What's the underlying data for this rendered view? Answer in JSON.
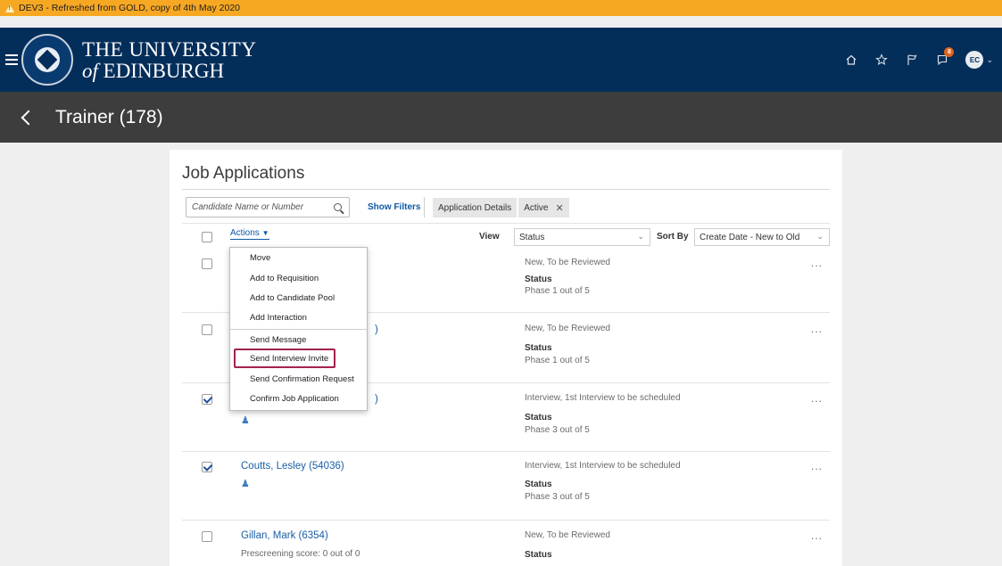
{
  "warning_bar": {
    "text": "DEV3 - Refreshed from GOLD, copy of 4th May 2020"
  },
  "header": {
    "title_line1": "THE UNIVERSITY",
    "title_of": "of",
    "title_line2": "EDINBURGH",
    "notification_count": "8",
    "avatar_initials": "EC",
    "colors": {
      "header_bg": "#042e5a",
      "warning_bg": "#f7a823",
      "badge": "#e2621b"
    }
  },
  "page": {
    "title": "Trainer (178)"
  },
  "panel": {
    "heading": "Job Applications",
    "search": {
      "placeholder": "Candidate Name or Number"
    },
    "show_filters": "Show Filters",
    "filter_pills": [
      {
        "label": "Application Details"
      },
      {
        "label": "Active",
        "removable": true
      }
    ],
    "actions_label": "Actions",
    "view_label": "View",
    "view_value": "Status",
    "sort_label": "Sort By",
    "sort_value": "Create Date - New to Old"
  },
  "actions_menu": {
    "items": [
      {
        "label": "Move"
      },
      {
        "label": "Add to Requisition"
      },
      {
        "label": "Add to Candidate Pool"
      },
      {
        "label": "Add Interaction"
      },
      {
        "label": "Send Message"
      },
      {
        "label": "Send Interview Invite",
        "highlighted": true
      },
      {
        "label": "Send Confirmation Request"
      },
      {
        "label": "Confirm Job Application"
      }
    ]
  },
  "applications": [
    {
      "name": "",
      "checked": false,
      "status_text": "New, To be Reviewed",
      "status_label": "Status",
      "phase": "Phase 1 out of 5"
    },
    {
      "name": ")",
      "checked": false,
      "status_text": "New, To be Reviewed",
      "status_label": "Status",
      "phase": "Phase 1 out of 5"
    },
    {
      "name": ")",
      "checked": true,
      "status_text": "Interview, 1st Interview to be scheduled",
      "status_label": "Status",
      "phase": "Phase 3 out of 5"
    },
    {
      "name": "Coutts, Lesley (54036)",
      "checked": true,
      "status_text": "Interview, 1st Interview to be scheduled",
      "status_label": "Status",
      "phase": "Phase 3 out of 5"
    },
    {
      "name": "Gillan, Mark (6354)",
      "checked": false,
      "sub": "Prescreening score: 0 out of 0",
      "status_text": "New, To be Reviewed",
      "status_label": "Status",
      "phase": ""
    }
  ],
  "more_glyph": "..."
}
